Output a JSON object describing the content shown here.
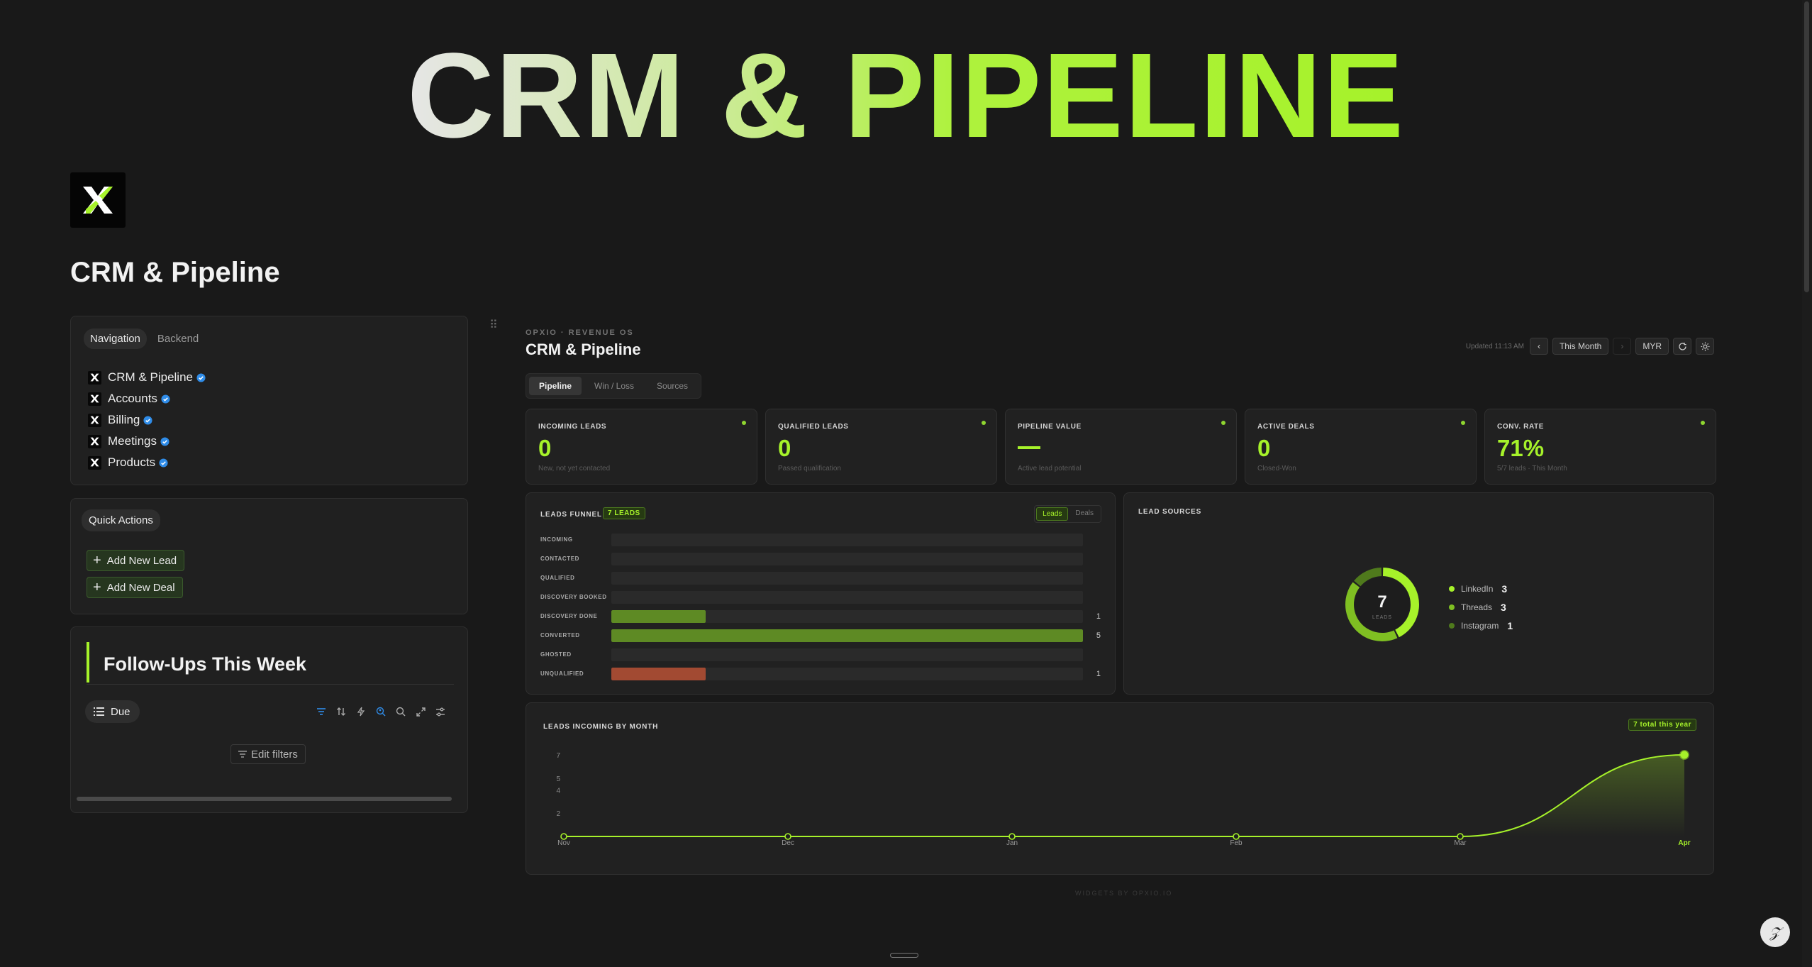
{
  "banner": {
    "text": "CRM & PIPELINE"
  },
  "page": {
    "title": "CRM & Pipeline"
  },
  "nav_panel": {
    "tabs": [
      "Navigation",
      "Backend"
    ],
    "items": [
      {
        "label": "CRM & Pipeline"
      },
      {
        "label": "Accounts"
      },
      {
        "label": "Billing"
      },
      {
        "label": "Meetings"
      },
      {
        "label": "Products"
      }
    ]
  },
  "quick_actions": {
    "label": "Quick Actions",
    "buttons": [
      "Add New Lead",
      "Add New Deal"
    ]
  },
  "followups": {
    "title": "Follow-Ups This Week",
    "view_label": "Due",
    "edit_filters_label": "Edit filters",
    "tool_icons": [
      "filter-icon",
      "sort-icon",
      "lightning-icon",
      "search-people-icon",
      "search-icon",
      "expand-icon",
      "settings-sliders-icon"
    ]
  },
  "dashboard": {
    "eyebrow": "OPXIO · REVENUE OS",
    "title": "CRM & Pipeline",
    "updated": "Updated 11:13 AM",
    "period": "This Month",
    "currency": "MYR",
    "tabs": [
      "Pipeline",
      "Win / Loss",
      "Sources"
    ],
    "kpis": [
      {
        "label": "INCOMING LEADS",
        "value": "0",
        "sub": "New, not yet contacted"
      },
      {
        "label": "QUALIFIED LEADS",
        "value": "0",
        "sub": "Passed qualification"
      },
      {
        "label": "PIPELINE VALUE",
        "value": "",
        "sub": "Active lead potential"
      },
      {
        "label": "ACTIVE DEALS",
        "value": "0",
        "sub": "Closed-Won"
      },
      {
        "label": "CONV. RATE",
        "value": "71%",
        "sub": "5/7 leads · This Month"
      }
    ],
    "funnel": {
      "title": "LEADS FUNNEL",
      "badge": "7 LEADS",
      "toggle": [
        "Leads",
        "Deals"
      ],
      "max": 5,
      "stages": [
        {
          "label": "INCOMING",
          "count": 0,
          "color": "#6b8f2e"
        },
        {
          "label": "CONTACTED",
          "count": 0,
          "color": "#6b8f2e"
        },
        {
          "label": "QUALIFIED",
          "count": 0,
          "color": "#6b8f2e"
        },
        {
          "label": "DISCOVERY BOOKED",
          "count": 0,
          "color": "#6b8f2e"
        },
        {
          "label": "DISCOVERY DONE",
          "count": 1,
          "color": "#5e8a24"
        },
        {
          "label": "CONVERTED",
          "count": 5,
          "color": "#5e8a24"
        },
        {
          "label": "GHOSTED",
          "count": 0,
          "color": "#6b8f2e"
        },
        {
          "label": "UNQUALIFIED",
          "count": 1,
          "color": "#a24a32"
        }
      ]
    },
    "sources": {
      "title": "LEAD SOURCES",
      "total": "7",
      "total_label": "LEADS",
      "items": [
        {
          "label": "LinkedIn",
          "value": 3,
          "color": "#a6f22a"
        },
        {
          "label": "Threads",
          "value": 3,
          "color": "#7fbf22"
        },
        {
          "label": "Instagram",
          "value": 1,
          "color": "#4f7a1c"
        }
      ]
    },
    "monthly": {
      "title": "LEADS INCOMING BY MONTH",
      "badge": "7 total this year"
    },
    "footer": "WIDGETS BY OPXIO.IO"
  },
  "chart_data": {
    "type": "area",
    "title": "LEADS INCOMING BY MONTH",
    "categories": [
      "Nov",
      "Dec",
      "Jan",
      "Feb",
      "Mar",
      "Apr"
    ],
    "values": [
      0,
      0,
      0,
      0,
      0,
      7
    ],
    "yticks": [
      "7",
      "5",
      "4",
      "2"
    ],
    "ylim": [
      0,
      7
    ],
    "highlight_category": "Apr",
    "line_color": "#a6f22a"
  }
}
